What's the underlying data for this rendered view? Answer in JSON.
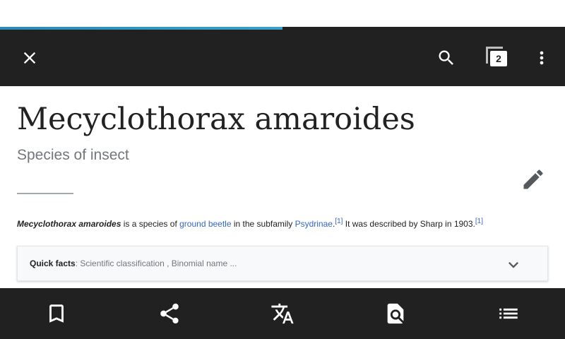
{
  "browser": {
    "load_progress_fraction": 0.5,
    "tab_count": "2"
  },
  "toolbar": {
    "close_icon": "close-icon",
    "search_icon": "search-icon",
    "tabs_icon": "tabs-icon",
    "menu_icon": "more-vert-icon"
  },
  "article": {
    "title": "Mecyclothorax amaroides",
    "description": "Species of insect",
    "lead": {
      "subject": "Mecyclothorax amaroides",
      "text_1": " is a species of ",
      "link_1": "ground beetle",
      "text_2": " in the subfamily ",
      "link_2": "Psydrinae",
      "text_3": ".",
      "ref_1": "[1]",
      "text_4": " It was described by Sharp in 1903.",
      "ref_2": "[1]"
    },
    "quick_facts": {
      "label": "Quick facts",
      "summary": ": Scientific classification , Binomial name ..."
    }
  },
  "bottom_bar": {
    "items": [
      "bookmark-icon",
      "share-icon",
      "translate-icon",
      "find-in-page-icon",
      "contents-icon"
    ]
  },
  "colors": {
    "toolbar_bg": "#212121",
    "link": "#3366cc",
    "progress": "#3aa0c8"
  }
}
